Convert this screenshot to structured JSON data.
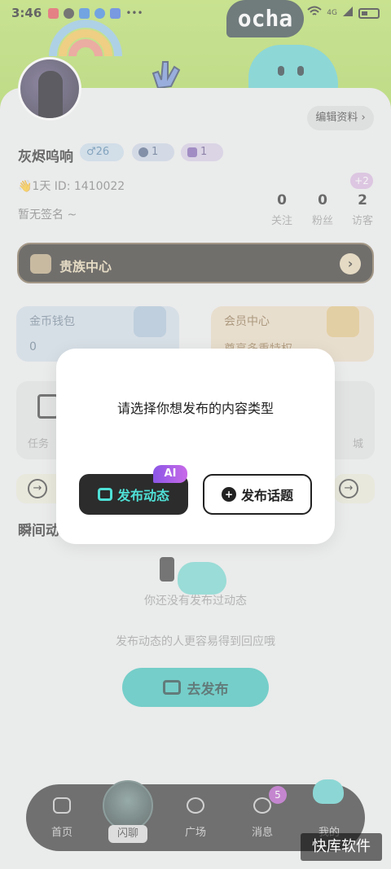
{
  "status_bar": {
    "time": "3:46",
    "signal": "4G",
    "battery_icon": "battery-icon"
  },
  "banner": {
    "logo_text": "ocha"
  },
  "profile": {
    "edit_label": "编辑资料 ›",
    "username": "灰烬呜响",
    "gender_age": "♂26",
    "badge_one": "1",
    "badge_two": "1",
    "meta": "👋1天  ID: 1410022",
    "signature": "暂无签名 ~",
    "stats": [
      {
        "num": "0",
        "label": "关注"
      },
      {
        "num": "0",
        "label": "粉丝"
      },
      {
        "num": "2",
        "label": "访客"
      }
    ],
    "visitor_plus": "+2"
  },
  "noble": {
    "label": "贵族中心",
    "arrow": "›"
  },
  "coin_wallet": {
    "title": "金币钱包",
    "value": "0"
  },
  "member_center": {
    "title": "会员中心",
    "value": "尊享多重特权"
  },
  "tasks": {
    "left_text": "任务",
    "right_text": "城"
  },
  "quick": {
    "left_icon": "→",
    "right_icon": "→"
  },
  "moments": {
    "title": "瞬间动",
    "empty_line_1": "你还没有发布过动态",
    "empty_line_2": "发布动态的人更容易得到回应哦",
    "go_post_label": "去发布"
  },
  "bottom_nav": {
    "home": "首页",
    "flash": "闪聊",
    "plaza": "广场",
    "messages": "消息",
    "message_count": "5",
    "mine": "我的"
  },
  "dialog": {
    "prompt": "请选择你想发布的内容类型",
    "post_dynamic": "发布动态",
    "ai_badge": "AI",
    "post_topic": "发布话题"
  },
  "watermark": "快库软件"
}
